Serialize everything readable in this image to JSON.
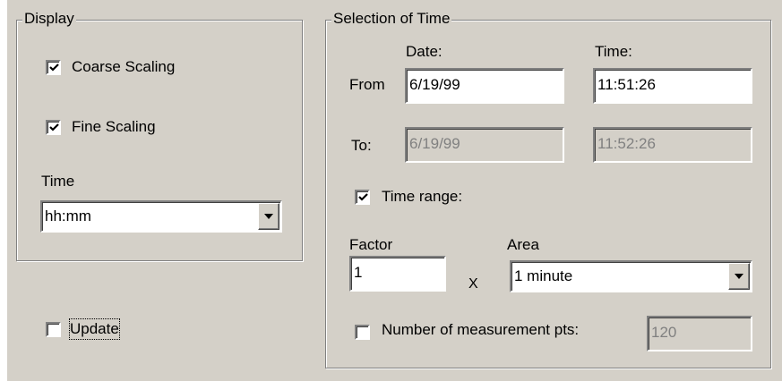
{
  "display_group": {
    "title": "Display",
    "coarse_scaling": {
      "label": "Coarse Scaling",
      "checked": true
    },
    "fine_scaling": {
      "label": "Fine Scaling",
      "checked": true
    },
    "time_label": "Time",
    "time_format": {
      "value": "hh:mm",
      "icon": "dropdown-arrow-icon"
    }
  },
  "update": {
    "label": "Update",
    "checked": false
  },
  "selection_group": {
    "title": "Selection of Time",
    "date_header": "Date:",
    "time_header": "Time:",
    "from_label": "From",
    "from_date": "6/19/99",
    "from_time": "11:51:26",
    "to_label": "To:",
    "to_date": "6/19/99",
    "to_time": "11:52:26",
    "time_range": {
      "label": "Time range:",
      "checked": true
    },
    "factor_label": "Factor",
    "factor_value": "1",
    "multiply_symbol": "X",
    "area_label": "Area",
    "area_value": "1 minute",
    "num_points": {
      "label": "Number of measurement pts:",
      "checked": false,
      "value": "120"
    }
  }
}
